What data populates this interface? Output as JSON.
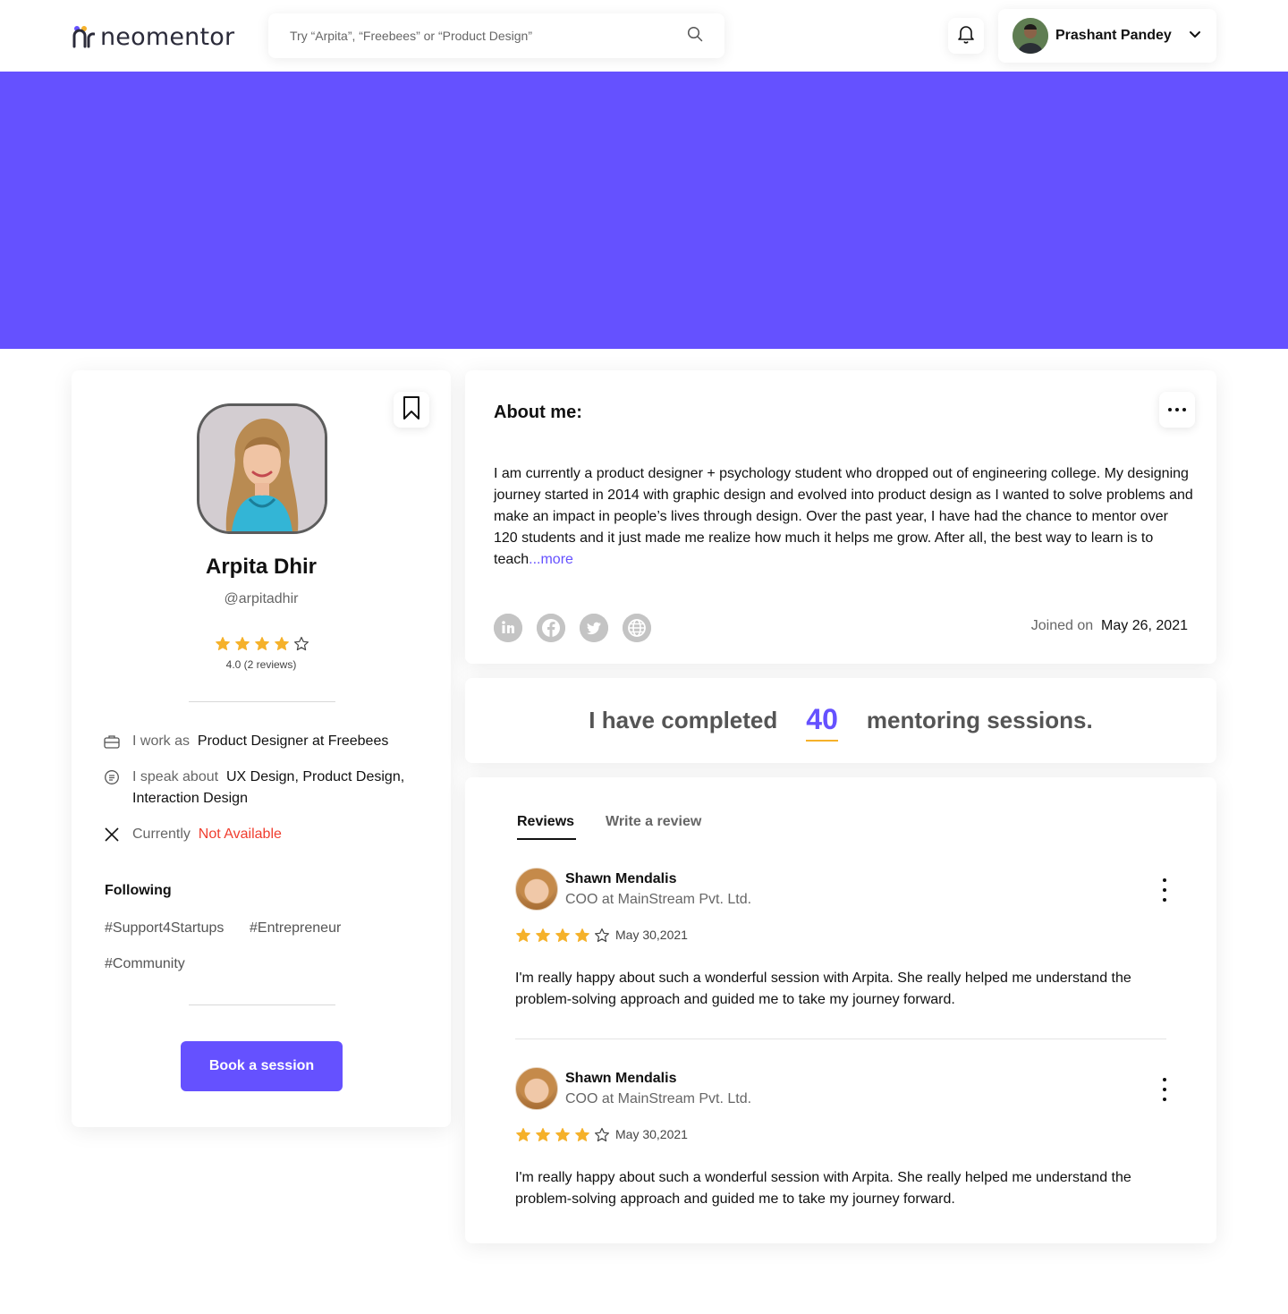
{
  "brand": {
    "name": "neomentor",
    "colors": {
      "primary": "#6551ff",
      "star": "#f5b12a",
      "danger": "#f03e2f",
      "logo_dots": [
        "#6551ff",
        "#f5b12a"
      ]
    }
  },
  "header": {
    "search_placeholder": "Try “Arpita”, “Freebees” or “Product Design”",
    "user_name": "Prashant Pandey",
    "icons": {
      "search": "search-icon",
      "bell": "bell-icon",
      "chevron": "chevron-down-icon"
    }
  },
  "profile": {
    "name": "Arpita Dhir",
    "handle": "@arpitadhir",
    "rating_text": "4.0 (2 reviews)",
    "rating": 4,
    "rating_max": 5,
    "work_label": "I work as",
    "work_value": "Product Designer at Freebees",
    "speak_label": "I speak about",
    "speak_value": "UX Design, Product Design, Interaction Design",
    "status_label": "Currently",
    "status_value": "Not Available",
    "following_title": "Following",
    "tags": [
      "#Support4Startups",
      "#Entrepreneur",
      "#Community"
    ],
    "book_label": "Book a session"
  },
  "about": {
    "title": "About me:",
    "text": "I am currently a product designer + psychology student who dropped out of engineering college. My designing journey started in 2014 with graphic design and evolved into product design as I wanted to solve problems and make an impact in people’s lives through design. Over the past year, I have had the chance to mentor over 120 students and it just made me realize how much it helps me grow. After all, the best way to learn is to teach",
    "more_label": "...more",
    "socials": [
      "in",
      "f",
      "t",
      "www"
    ],
    "joined_label": "Joined on",
    "joined_date": "May 26, 2021"
  },
  "sessions": {
    "prefix": "I have completed",
    "count": "40",
    "suffix": "mentoring sessions."
  },
  "reviews": {
    "tabs": [
      "Reviews",
      "Write a review"
    ],
    "items": [
      {
        "name": "Shawn Mendalis",
        "role": "COO at MainStream Pvt. Ltd.",
        "rating": 4,
        "date": "May 30,2021",
        "text": "I'm really happy about such a wonderful session with Arpita. She really helped me understand the problem-solving approach and guided me to take my journey forward."
      },
      {
        "name": "Shawn Mendalis",
        "role": "COO at MainStream Pvt. Ltd.",
        "rating": 4,
        "date": "May 30,2021",
        "text": "I'm really happy about such a wonderful session with Arpita. She really helped me understand the problem-solving approach and guided me to take my journey forward."
      }
    ]
  }
}
